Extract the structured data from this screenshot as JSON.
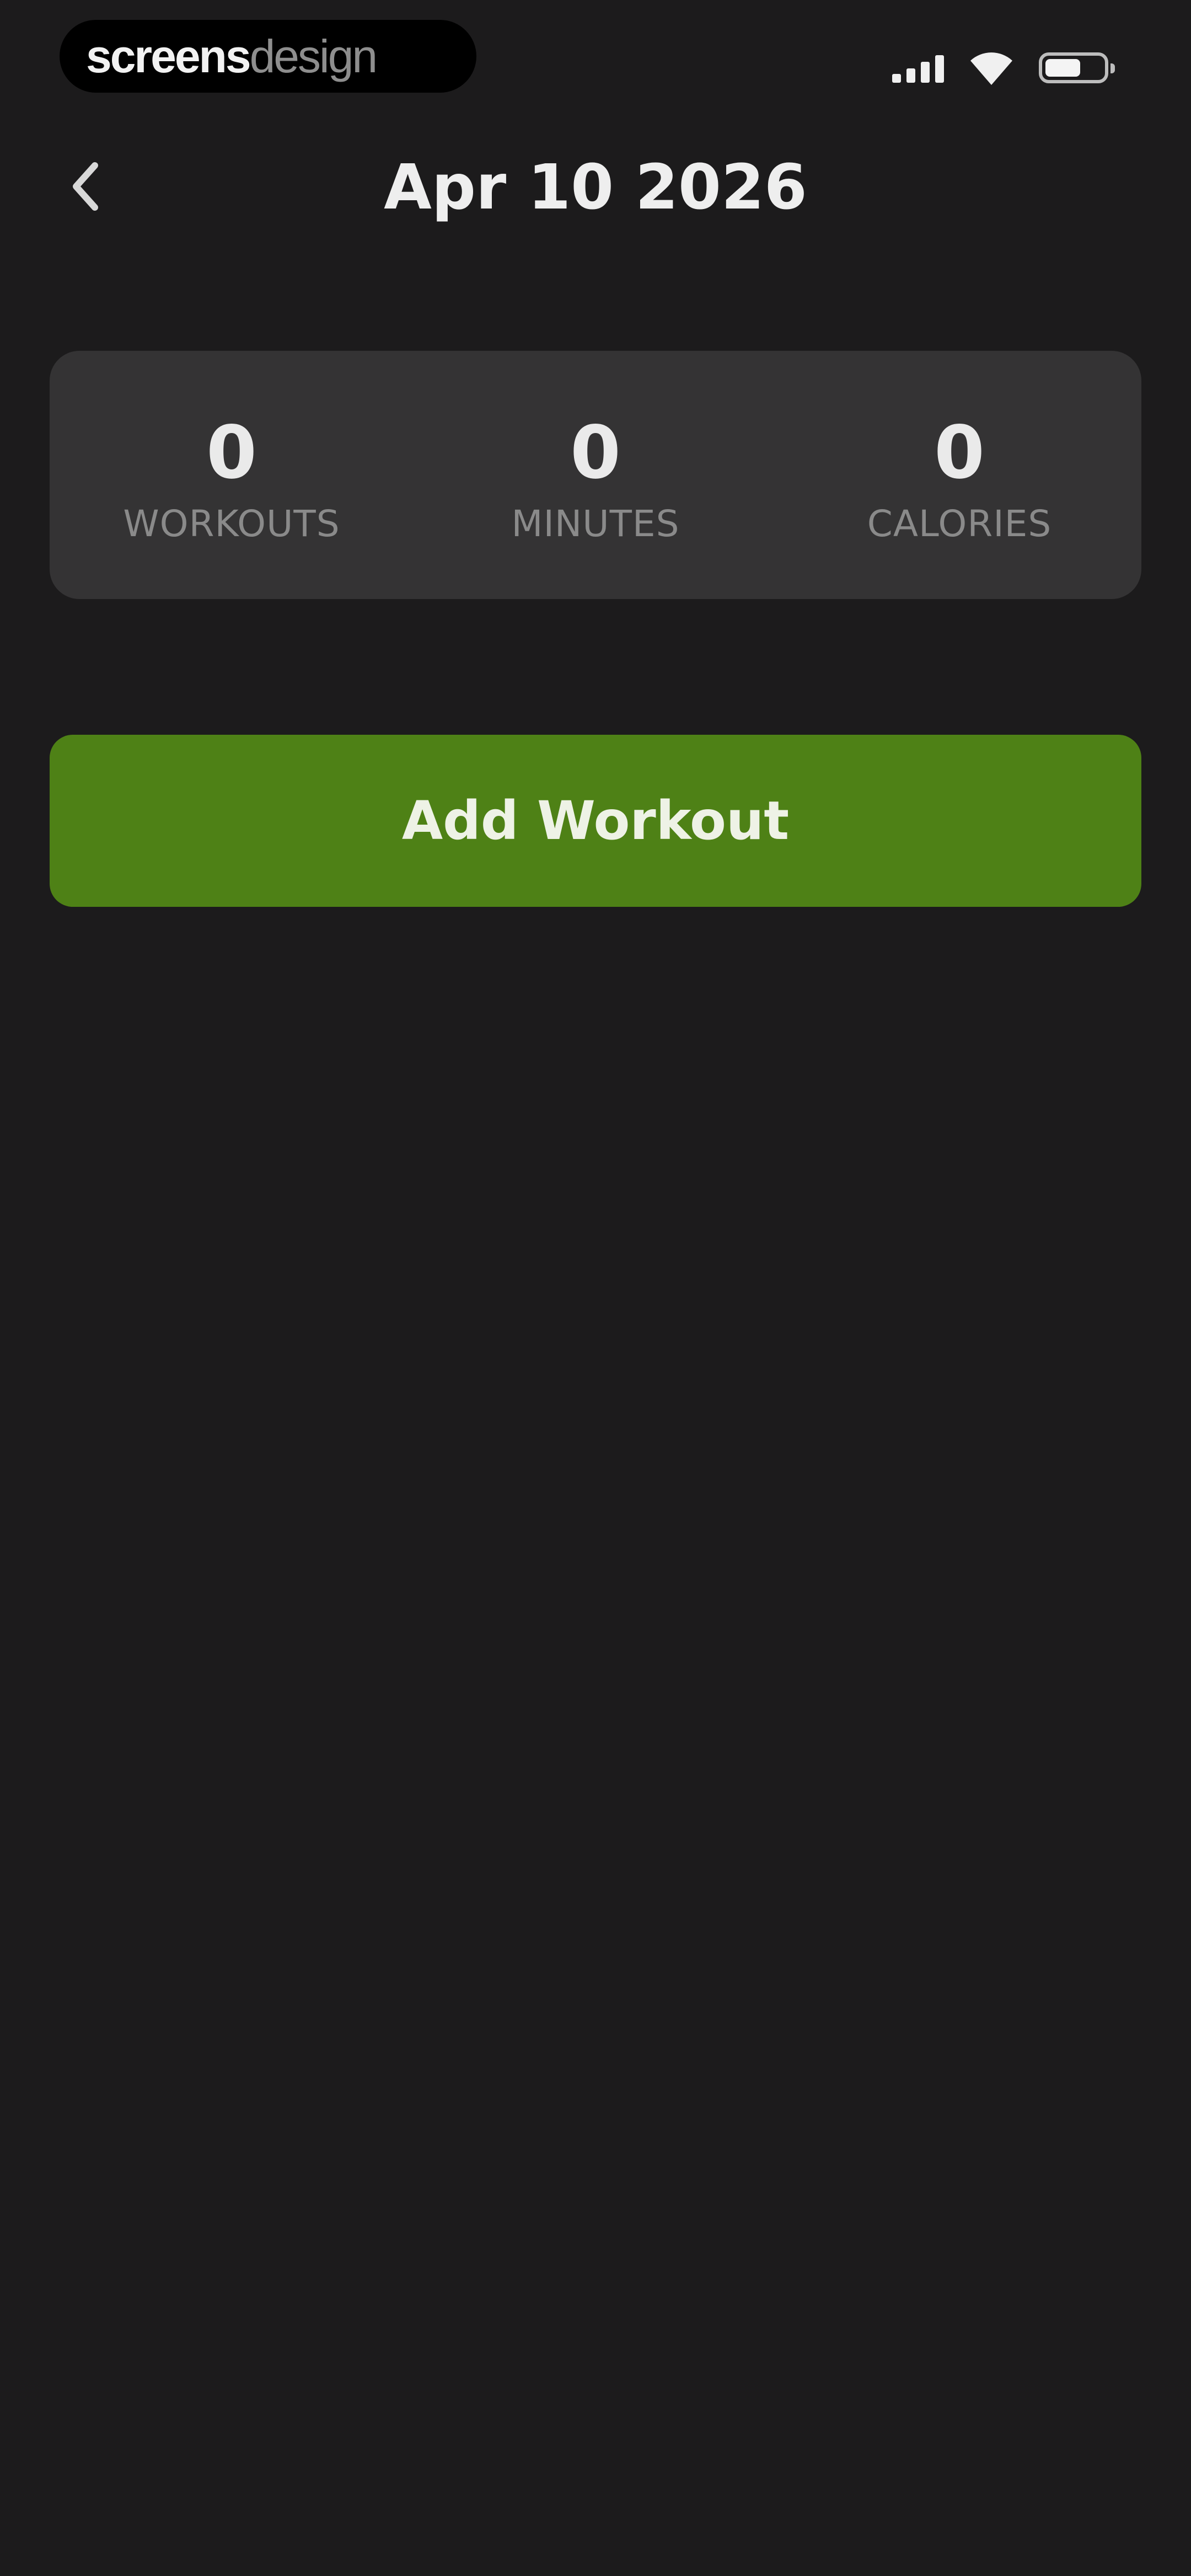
{
  "status_bar": {
    "watermark_bold": "screens",
    "watermark_light": "design",
    "icons": [
      "cellular-signal-icon",
      "wifi-icon",
      "battery-icon"
    ]
  },
  "header": {
    "title": "Apr 10 2026",
    "back_icon": "chevron-left-icon"
  },
  "stats": [
    {
      "value": "0",
      "label": "WORKOUTS"
    },
    {
      "value": "0",
      "label": "MINUTES"
    },
    {
      "value": "0",
      "label": "CALORIES"
    }
  ],
  "actions": {
    "add_workout_label": "Add Workout"
  },
  "colors": {
    "background": "#1c1b1c",
    "card": "#343334",
    "accent": "#4e8116",
    "label": "#8a8a8a"
  }
}
